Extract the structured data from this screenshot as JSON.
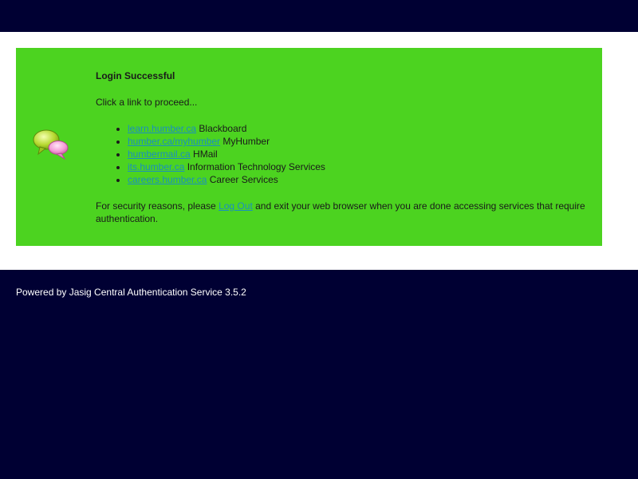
{
  "message": {
    "title": "Login Successful",
    "instruction": "Click a link to proceed...",
    "icon": "speech-bubbles-icon",
    "links": [
      {
        "link_text": "learn.humber.ca",
        "description": "Blackboard"
      },
      {
        "link_text": "humber.ca/myhumber",
        "description": "MyHumber"
      },
      {
        "link_text": "humbermail.ca",
        "description": "HMail"
      },
      {
        "link_text": "its.humber.ca",
        "description": "Information Technology Services"
      },
      {
        "link_text": "careers.humber.ca",
        "description": "Career Services"
      }
    ],
    "security_prefix": "For security reasons, please",
    "logout_link": "Log Out",
    "security_suffix": "and exit your web browser when you are done accessing services that require authentication."
  },
  "footer": {
    "text": "Powered by Jasig Central Authentication Service 3.5.2"
  },
  "colors": {
    "header_bg": "#000033",
    "message_bg": "#4cd320",
    "link": "#1a8fbf"
  }
}
